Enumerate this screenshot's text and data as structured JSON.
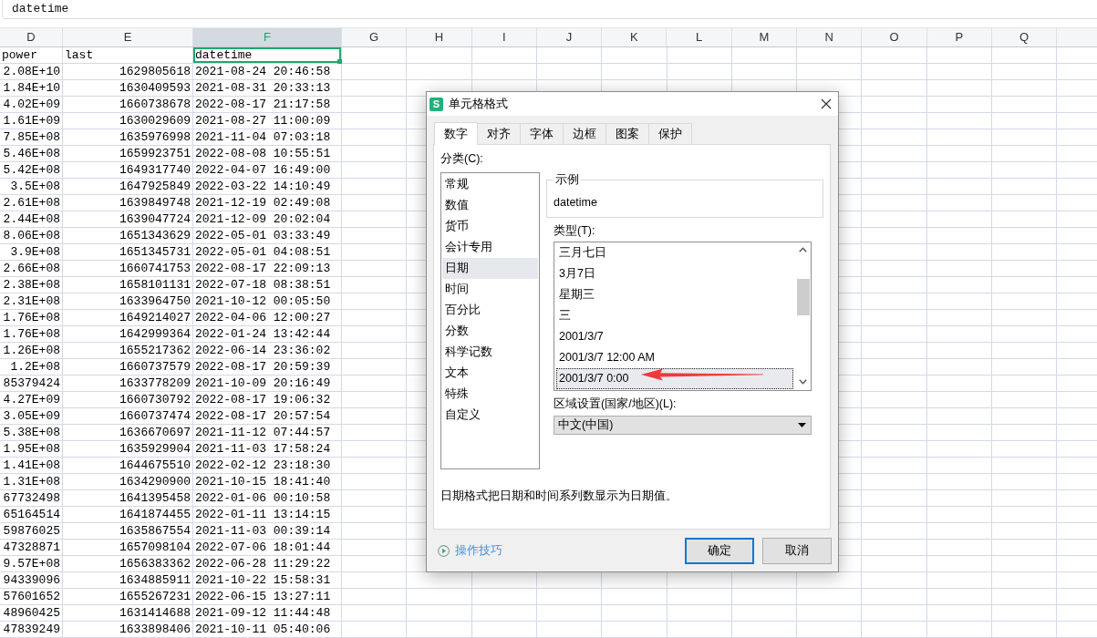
{
  "formula_bar": {
    "value": "datetime"
  },
  "sheet": {
    "columns": [
      {
        "label": "D",
        "kind": "number",
        "selected": false
      },
      {
        "label": "E",
        "kind": "number",
        "selected": false
      },
      {
        "label": "F",
        "kind": "text",
        "selected": true
      },
      {
        "label": "G",
        "selected": false
      },
      {
        "label": "H",
        "selected": false
      },
      {
        "label": "I",
        "selected": false
      },
      {
        "label": "J",
        "selected": false
      },
      {
        "label": "K",
        "selected": false
      },
      {
        "label": "L",
        "selected": false
      },
      {
        "label": "M",
        "selected": false
      },
      {
        "label": "N",
        "selected": false
      },
      {
        "label": "O",
        "selected": false
      },
      {
        "label": "P",
        "selected": false
      },
      {
        "label": "Q",
        "selected": false
      }
    ],
    "rows": [
      {
        "kind": "header",
        "selected": true,
        "cells": [
          "power",
          "last",
          "datetime"
        ]
      },
      {
        "kind": "data",
        "selected": false,
        "cells": [
          "2.08E+10",
          "1629805618",
          "2021-08-24 20:46:58"
        ]
      },
      {
        "kind": "data",
        "selected": false,
        "cells": [
          "1.84E+10",
          "1630409593",
          "2021-08-31 20:33:13"
        ]
      },
      {
        "kind": "data",
        "selected": false,
        "cells": [
          "4.02E+09",
          "1660738678",
          "2022-08-17 21:17:58"
        ]
      },
      {
        "kind": "data",
        "selected": false,
        "cells": [
          "1.61E+09",
          "1630029609",
          "2021-08-27 11:00:09"
        ]
      },
      {
        "kind": "data",
        "selected": false,
        "cells": [
          "7.85E+08",
          "1635976998",
          "2021-11-04 07:03:18"
        ]
      },
      {
        "kind": "data",
        "selected": false,
        "cells": [
          "5.46E+08",
          "1659923751",
          "2022-08-08 10:55:51"
        ]
      },
      {
        "kind": "data",
        "selected": false,
        "cells": [
          "5.42E+08",
          "1649317740",
          "2022-04-07 16:49:00"
        ]
      },
      {
        "kind": "data",
        "selected": false,
        "cells": [
          "3.5E+08",
          "1647925849",
          "2022-03-22 14:10:49"
        ]
      },
      {
        "kind": "data",
        "selected": false,
        "cells": [
          "2.61E+08",
          "1639849748",
          "2021-12-19 02:49:08"
        ]
      },
      {
        "kind": "data",
        "selected": false,
        "cells": [
          "2.44E+08",
          "1639047724",
          "2021-12-09 20:02:04"
        ]
      },
      {
        "kind": "data",
        "selected": false,
        "cells": [
          "8.06E+08",
          "1651343629",
          "2022-05-01 03:33:49"
        ]
      },
      {
        "kind": "data",
        "selected": false,
        "cells": [
          "3.9E+08",
          "1651345731",
          "2022-05-01 04:08:51"
        ]
      },
      {
        "kind": "data",
        "selected": false,
        "cells": [
          "2.66E+08",
          "1660741753",
          "2022-08-17 22:09:13"
        ]
      },
      {
        "kind": "data",
        "selected": false,
        "cells": [
          "2.38E+08",
          "1658101131",
          "2022-07-18 08:38:51"
        ]
      },
      {
        "kind": "data",
        "selected": false,
        "cells": [
          "2.31E+08",
          "1633964750",
          "2021-10-12 00:05:50"
        ]
      },
      {
        "kind": "data",
        "selected": false,
        "cells": [
          "1.76E+08",
          "1649214027",
          "2022-04-06 12:00:27"
        ]
      },
      {
        "kind": "data",
        "selected": false,
        "cells": [
          "1.76E+08",
          "1642999364",
          "2022-01-24 13:42:44"
        ]
      },
      {
        "kind": "data",
        "selected": false,
        "cells": [
          "1.26E+08",
          "1655217362",
          "2022-06-14 23:36:02"
        ]
      },
      {
        "kind": "data",
        "selected": false,
        "cells": [
          "1.2E+08",
          "1660737579",
          "2022-08-17 20:59:39"
        ]
      },
      {
        "kind": "data",
        "selected": false,
        "cells": [
          "85379424",
          "1633778209",
          "2021-10-09 20:16:49"
        ]
      },
      {
        "kind": "data",
        "selected": false,
        "cells": [
          "4.27E+09",
          "1660730792",
          "2022-08-17 19:06:32"
        ]
      },
      {
        "kind": "data",
        "selected": false,
        "cells": [
          "3.05E+09",
          "1660737474",
          "2022-08-17 20:57:54"
        ]
      },
      {
        "kind": "data",
        "selected": false,
        "cells": [
          "5.38E+08",
          "1636670697",
          "2021-11-12 07:44:57"
        ]
      },
      {
        "kind": "data",
        "selected": false,
        "cells": [
          "1.95E+08",
          "1635929904",
          "2021-11-03 17:58:24"
        ]
      },
      {
        "kind": "data",
        "selected": false,
        "cells": [
          "1.41E+08",
          "1644675510",
          "2022-02-12 23:18:30"
        ]
      },
      {
        "kind": "data",
        "selected": false,
        "cells": [
          "1.31E+08",
          "1634290900",
          "2021-10-15 18:41:40"
        ]
      },
      {
        "kind": "data",
        "selected": false,
        "cells": [
          "67732498",
          "1641395458",
          "2022-01-06 00:10:58"
        ]
      },
      {
        "kind": "data",
        "selected": false,
        "cells": [
          "65164514",
          "1641874455",
          "2022-01-11 13:14:15"
        ]
      },
      {
        "kind": "data",
        "selected": false,
        "cells": [
          "59876025",
          "1635867554",
          "2021-11-03 00:39:14"
        ]
      },
      {
        "kind": "data",
        "selected": false,
        "cells": [
          "47328871",
          "1657098104",
          "2022-07-06 18:01:44"
        ]
      },
      {
        "kind": "data",
        "selected": false,
        "cells": [
          "9.57E+08",
          "1656383362",
          "2022-06-28 11:29:22"
        ]
      },
      {
        "kind": "data",
        "selected": false,
        "cells": [
          "94339096",
          "1634885911",
          "2021-10-22 15:58:31"
        ]
      },
      {
        "kind": "data",
        "selected": false,
        "cells": [
          "57601652",
          "1655267231",
          "2022-06-15 13:27:11"
        ]
      },
      {
        "kind": "data",
        "selected": false,
        "cells": [
          "48960425",
          "1631414688",
          "2021-09-12 11:44:48"
        ]
      },
      {
        "kind": "data",
        "selected": false,
        "cells": [
          "47839249",
          "1633898406",
          "2021-10-11 05:40:06"
        ]
      }
    ]
  },
  "dialog": {
    "title": "单元格格式",
    "icon_letter": "S",
    "tabs": [
      {
        "label": "数字",
        "selected": true
      },
      {
        "label": "对齐",
        "selected": false
      },
      {
        "label": "字体",
        "selected": false
      },
      {
        "label": "边框",
        "selected": false
      },
      {
        "label": "图案",
        "selected": false
      },
      {
        "label": "保护",
        "selected": false
      }
    ],
    "category": {
      "label": "分类(C):",
      "items": [
        {
          "label": "常规",
          "selected": false
        },
        {
          "label": "数值",
          "selected": false
        },
        {
          "label": "货币",
          "selected": false
        },
        {
          "label": "会计专用",
          "selected": false
        },
        {
          "label": "日期",
          "selected": true
        },
        {
          "label": "时间",
          "selected": false
        },
        {
          "label": "百分比",
          "selected": false
        },
        {
          "label": "分数",
          "selected": false
        },
        {
          "label": "科学记数",
          "selected": false
        },
        {
          "label": "文本",
          "selected": false
        },
        {
          "label": "特殊",
          "selected": false
        },
        {
          "label": "自定义",
          "selected": false
        }
      ]
    },
    "sample": {
      "legend": "示例",
      "value": "datetime"
    },
    "type": {
      "label": "类型(T):",
      "items": [
        {
          "label": "三月七日",
          "selected": false
        },
        {
          "label": "3月7日",
          "selected": false
        },
        {
          "label": "星期三",
          "selected": false
        },
        {
          "label": "三",
          "selected": false
        },
        {
          "label": "2001/3/7",
          "selected": false
        },
        {
          "label": "2001/3/7 12:00 AM",
          "selected": false
        },
        {
          "label": "2001/3/7 0:00",
          "selected": true
        }
      ]
    },
    "locale": {
      "label": "区域设置(国家/地区)(L):",
      "value": "中文(中国)"
    },
    "description": "日期格式把日期和时间系列数显示为日期值。",
    "help_link": "操作技巧",
    "buttons": [
      {
        "label": "确定",
        "default": true
      },
      {
        "label": "取消",
        "default": false
      }
    ]
  }
}
